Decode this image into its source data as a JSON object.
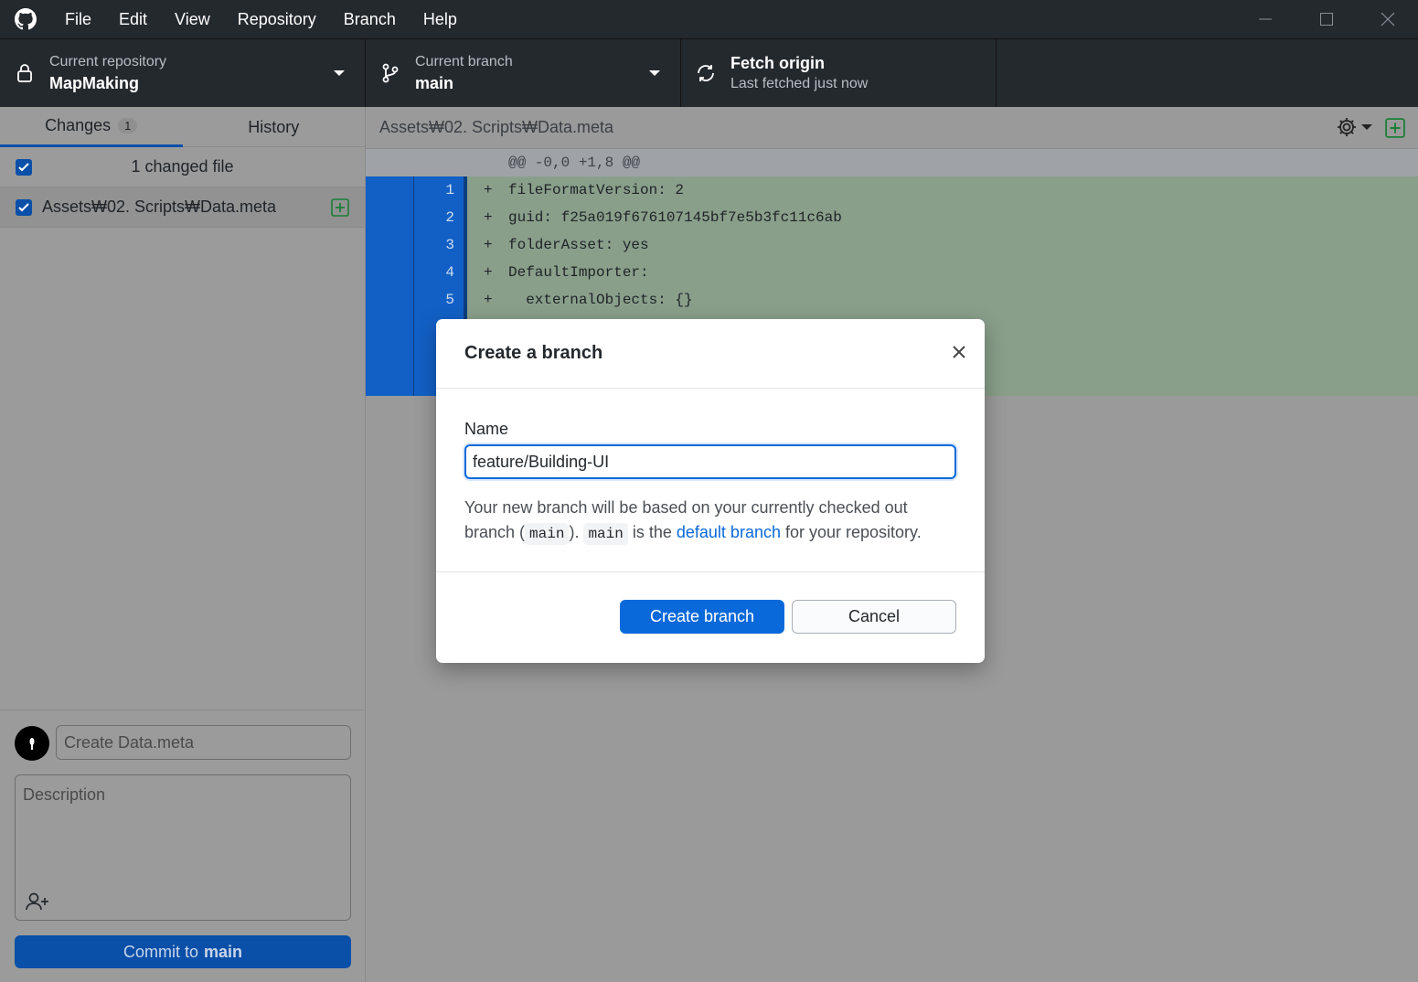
{
  "menu": [
    "File",
    "Edit",
    "View",
    "Repository",
    "Branch",
    "Help"
  ],
  "toolbar": {
    "repo_label": "Current repository",
    "repo_value": "MapMaking",
    "branch_label": "Current branch",
    "branch_value": "main",
    "fetch_label": "Fetch origin",
    "fetch_status": "Last fetched just now"
  },
  "sidebar": {
    "tab_changes": "Changes",
    "changes_count": "1",
    "tab_history": "History",
    "changed_files_header": "1 changed file",
    "files": [
      {
        "name": "Assets₩02. Scripts₩Data.meta",
        "checked": true,
        "status": "added"
      }
    ],
    "commit": {
      "summary_placeholder": "Create Data.meta",
      "description_placeholder": "Description",
      "button_prefix": "Commit to",
      "button_branch": "main"
    }
  },
  "diff": {
    "path": "Assets₩02. Scripts₩Data.meta",
    "hunk_header": "@@ -0,0 +1,8 @@",
    "lines": [
      {
        "num": "1",
        "marker": "+",
        "text": "fileFormatVersion: 2"
      },
      {
        "num": "2",
        "marker": "+",
        "text": "guid: f25a019f676107145bf7e5b3fc11c6ab"
      },
      {
        "num": "3",
        "marker": "+",
        "text": "folderAsset: yes"
      },
      {
        "num": "4",
        "marker": "+",
        "text": "DefaultImporter:"
      },
      {
        "num": "5",
        "marker": "+",
        "text": "  externalObjects: {}"
      },
      {
        "num": "",
        "marker": "",
        "text": ""
      },
      {
        "num": "",
        "marker": "",
        "text": ""
      },
      {
        "num": "",
        "marker": "",
        "text": ""
      }
    ]
  },
  "dialog": {
    "title": "Create a branch",
    "name_label": "Name",
    "name_value": "feature/Building-UI",
    "hint_1": "Your new branch will be based on your currently checked out branch (",
    "hint_chip_1": "main",
    "hint_2": "). ",
    "hint_chip_2": "main",
    "hint_3": " is the ",
    "hint_link": "default branch",
    "hint_4": " for your repository.",
    "primary_button": "Create branch",
    "secondary_button": "Cancel"
  },
  "colors": {
    "accent": "#0969da",
    "titlebar": "#24292e",
    "added_line": "#899f8a",
    "gutter_added": "#1260c6"
  }
}
